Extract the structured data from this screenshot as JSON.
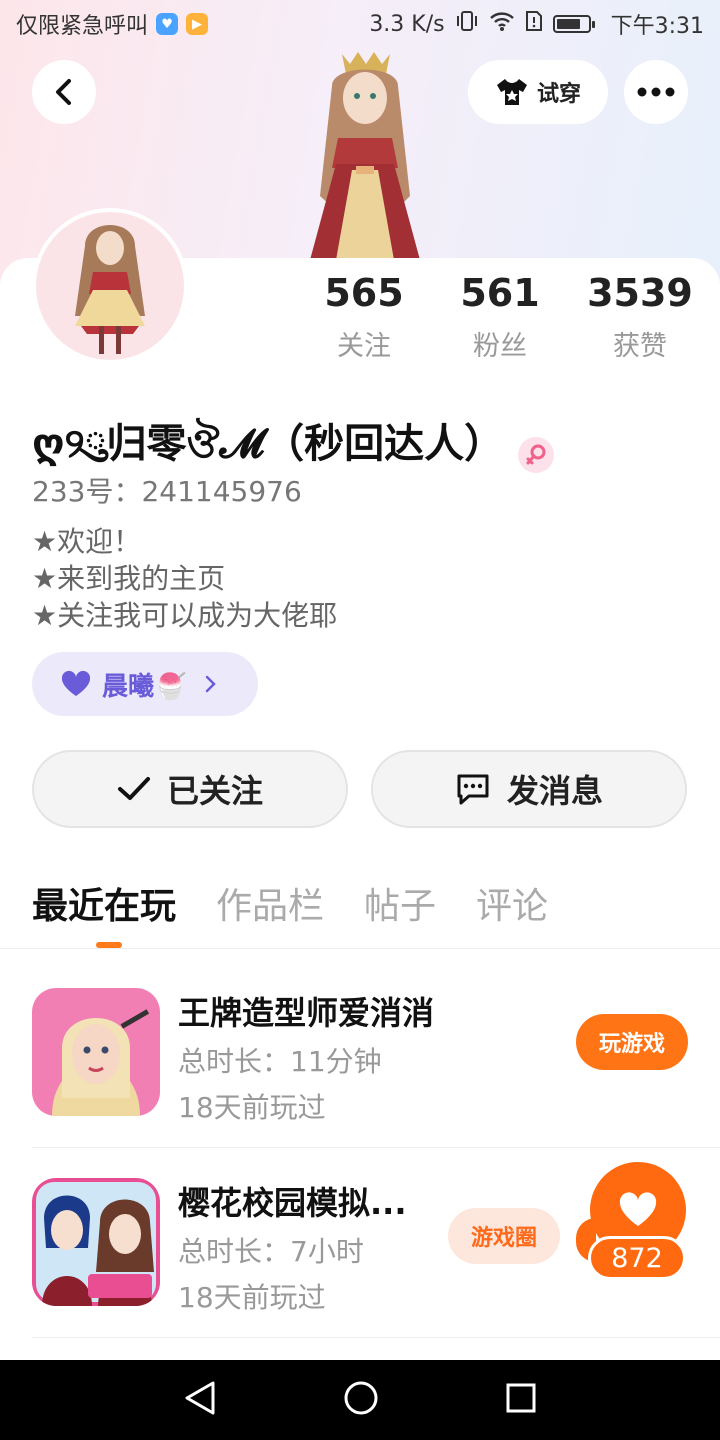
{
  "status_bar": {
    "carrier_text": "仅限紧急呼叫",
    "network_speed": "3.3 K/s",
    "time": "下午3:31"
  },
  "top_bar": {
    "try_on_label": "试穿"
  },
  "profile": {
    "stats": [
      {
        "value": "565",
        "label": "关注"
      },
      {
        "value": "561",
        "label": "粉丝"
      },
      {
        "value": "3539",
        "label": "获赞"
      }
    ],
    "nickname": "ღ୨ུ归零ঔ𝓜（秒回达人）",
    "uid": "233号：241145976",
    "bio": [
      "★欢迎！",
      "★来到我的主页",
      "★关注我可以成为大佬耶"
    ],
    "tag_label": "晨曦🍧"
  },
  "actions": {
    "followed_label": "已关注",
    "message_label": "发消息"
  },
  "tabs": [
    "最近在玩",
    "作品栏",
    "帖子",
    "评论"
  ],
  "games": [
    {
      "title": "王牌造型师爱消消",
      "duration": "总时长：11分钟",
      "last_played": "18天前玩过",
      "button": "玩游戏"
    },
    {
      "title": "樱花校园模拟...",
      "duration": "总时长：7小时",
      "last_played": "18天前玩过",
      "button": "游戏圈"
    }
  ],
  "like_count": "872",
  "colors": {
    "accent": "#ff7414",
    "tag_purple": "#6a5bd8",
    "tag_bg": "#ece9fb"
  }
}
